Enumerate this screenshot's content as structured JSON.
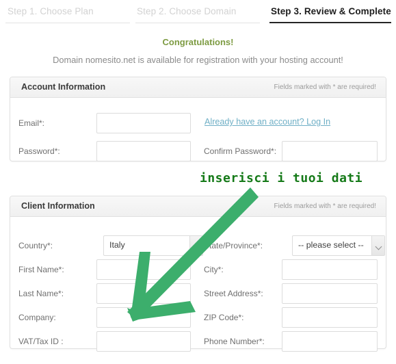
{
  "colors": {
    "accent_green": "#3cae6c",
    "annotation_green": "#157a18",
    "congrats_green": "#7d9b42",
    "link_blue": "#6fafc6",
    "panel_border": "#e0e0e0",
    "label_gray": "#6f6f6f",
    "inactive_step": "#d2d2d2"
  },
  "steps": [
    {
      "label": "Step 1. Choose Plan",
      "active": false
    },
    {
      "label": "Step 2. Choose Domain",
      "active": false
    },
    {
      "label": "Step 3. Review & Complete",
      "active": true
    }
  ],
  "status": {
    "congratulations": "Congratulations!",
    "domain_message": "Domain nomesito.net is available for registration with your hosting account!"
  },
  "account_panel": {
    "title": "Account Information",
    "required_note": "Fields marked with * are required!",
    "login_link": "Already have an account? Log In",
    "fields": [
      {
        "label": "Email*:",
        "value": "",
        "placeholder": "",
        "type": "text",
        "side": "left"
      },
      {
        "label": "Password*:",
        "value": "",
        "placeholder": "",
        "type": "password",
        "side": "left"
      },
      {
        "label": "Confirm Password*:",
        "value": "",
        "placeholder": "",
        "type": "password",
        "side": "right"
      }
    ]
  },
  "client_panel": {
    "title": "Client Information",
    "required_note": "Fields marked with * are required!",
    "left_fields": [
      {
        "label": "Country*:",
        "value": "Italy",
        "type": "select"
      },
      {
        "label": "First Name*:",
        "value": "",
        "type": "text"
      },
      {
        "label": "Last Name*:",
        "value": "",
        "type": "text"
      },
      {
        "label": "Company:",
        "value": "",
        "type": "text"
      },
      {
        "label": "VAT/Tax ID :",
        "value": "",
        "type": "text"
      }
    ],
    "right_fields": [
      {
        "label": "State/Province*:",
        "value": "-- please select --",
        "type": "select"
      },
      {
        "label": "City*:",
        "value": "",
        "type": "text"
      },
      {
        "label": "Street Address*:",
        "value": "",
        "type": "text"
      },
      {
        "label": "ZIP Code*:",
        "value": "",
        "type": "text"
      },
      {
        "label": "Phone Number*:",
        "value": "",
        "type": "text"
      }
    ]
  },
  "annotation": {
    "text": "inserisci i tuoi dati",
    "arrow": "green-arrow-pointing-down-left"
  }
}
